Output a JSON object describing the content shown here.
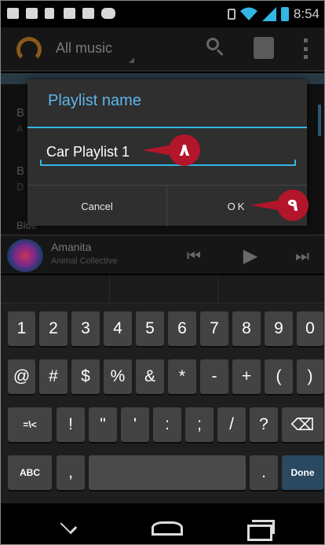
{
  "status_bar": {
    "time": "8:54",
    "icons": [
      "email-icon",
      "chat-icon",
      "phone-icon",
      "bag-icon",
      "bag-icon",
      "gamepad-icon"
    ]
  },
  "action_bar": {
    "title": "All music"
  },
  "background_list": {
    "letters": [
      "B",
      "A",
      "B",
      "D",
      "Blue"
    ]
  },
  "dialog": {
    "title": "Playlist name",
    "input_value": "Car Playlist 1",
    "cancel_label": "Cancel",
    "ok_label": "OK"
  },
  "markers": {
    "input_marker": "٨",
    "ok_marker": "٩"
  },
  "now_playing": {
    "title": "Amanita",
    "artist": "Animal Collective"
  },
  "keyboard": {
    "row1": [
      "1",
      "2",
      "3",
      "4",
      "5",
      "6",
      "7",
      "8",
      "9",
      "0"
    ],
    "row2": [
      "@",
      "#",
      "$",
      "%",
      "&",
      "*",
      "-",
      "+",
      "(",
      ")"
    ],
    "row3": [
      "=\\<",
      "!",
      "\"",
      "'",
      ":",
      ";",
      "/",
      "?",
      "⌫"
    ],
    "row4": [
      "ABC",
      ",",
      " ",
      ".",
      "Done"
    ]
  },
  "colors": {
    "accent": "#33b5e5",
    "marker": "#b3152b",
    "done_key": "#2a4960"
  }
}
